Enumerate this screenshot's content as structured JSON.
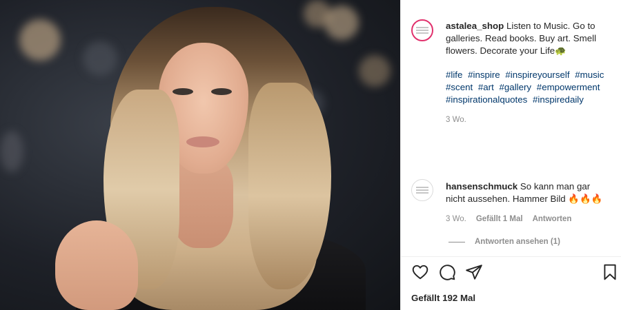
{
  "post": {
    "username": "astalea_shop",
    "caption": "Listen to Music. Go to galleries. Read books. Buy art. Smell flowers. Decorate your Life",
    "caption_emoji": "🐢",
    "hashtags": [
      "#life",
      "#inspire",
      "#inspireyourself",
      "#music",
      "#scent",
      "#art",
      "#gallery",
      "#empowerment",
      "#inspirationalquotes",
      "#inspiredaily"
    ],
    "time": "3 Wo."
  },
  "comment": {
    "username": "hansenschmuck",
    "text": "So kann man gar nicht aussehen. Hammer Bild",
    "emojis": "🔥🔥🔥",
    "time": "3 Wo.",
    "likes": "Gefällt 1 Mal",
    "reply": "Antworten",
    "view_replies": "Antworten ansehen (1)"
  },
  "actions": {
    "like_icon": "heart-icon",
    "comment_icon": "comment-icon",
    "share_icon": "share-icon",
    "save_icon": "bookmark-icon"
  },
  "likes_count": "Gefällt 192 Mal",
  "colors": {
    "link": "#00376b",
    "muted": "#8e8e8e",
    "text": "#262626",
    "story_ring": "#e1306c"
  }
}
